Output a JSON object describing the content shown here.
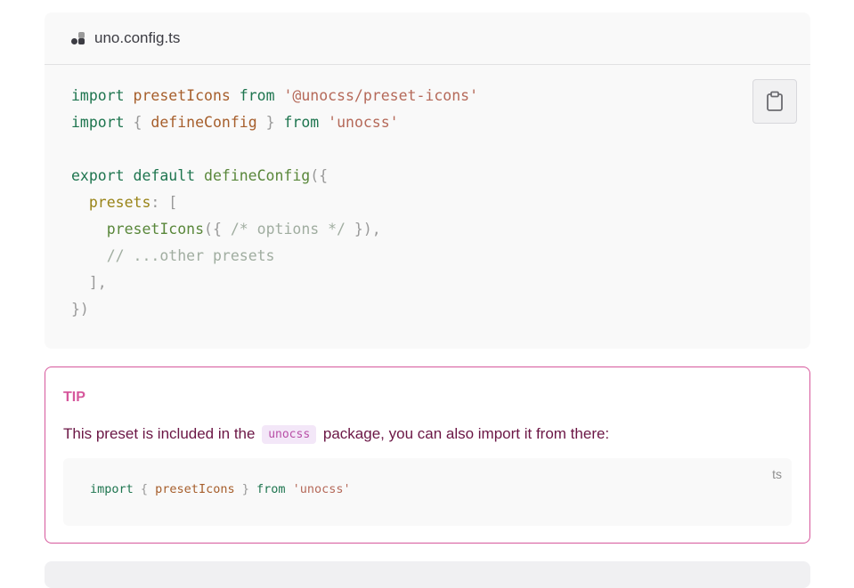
{
  "code_block": {
    "filename": "uno.config.ts",
    "file_icon": "unocss-logo-icon",
    "copy_icon": "clipboard-icon",
    "lines": [
      {
        "t1": "import",
        "t2": " ",
        "t3": "presetIcons",
        "t4": " ",
        "t5": "from",
        "t6": " ",
        "t7": "'@unocss/preset-icons'"
      },
      {
        "t1": "import",
        "t2": " { ",
        "t3": "defineConfig",
        "t4": " } ",
        "t5": "from",
        "t6": " ",
        "t7": "'unocss'"
      }
    ],
    "line4_kw": "export default",
    "line4_fn": "defineConfig",
    "line4_p": "({",
    "line5_prop": "presets",
    "line5_p": ": [",
    "line6_fn": "presetIcons",
    "line6_p1": "({ ",
    "line6_cm": "/* options */",
    "line6_p2": " }),",
    "line7_cm": "// ...other presets",
    "line8_p": "],",
    "line9_p": "})"
  },
  "tip": {
    "title": "TIP",
    "text_before": "This preset is included in the",
    "inline_code": "unocss",
    "text_after": "package, you can also import it from there:",
    "lang": "ts",
    "code_kw1": "import",
    "code_p1": " { ",
    "code_id": "presetIcons",
    "code_p2": " } ",
    "code_kw2": "from",
    "code_str": "'unocss'"
  },
  "colors": {
    "tip_border": "#d6579c",
    "keyword": "#1e754f",
    "string": "#b56959"
  }
}
